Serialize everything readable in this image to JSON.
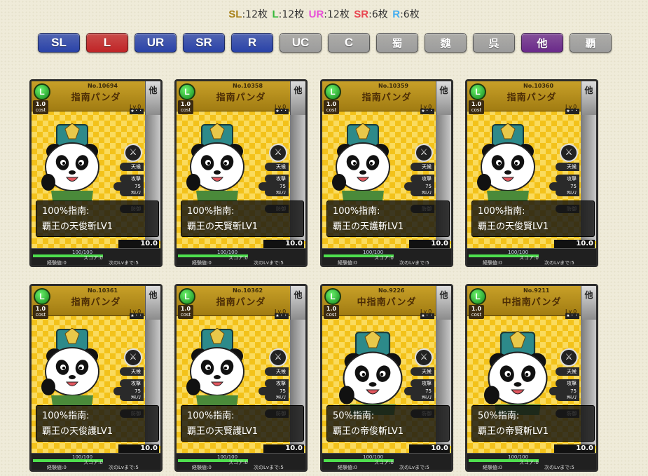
{
  "summary": [
    {
      "label": "SL",
      "count": "12枚",
      "color": "#a8821a"
    },
    {
      "label": "L",
      "count": "12枚",
      "color": "#35b83a"
    },
    {
      "label": "UR",
      "count": "12枚",
      "color": "#e84fd8"
    },
    {
      "label": "SR",
      "count": "6枚",
      "color": "#e8454f"
    },
    {
      "label": "R",
      "count": "6枚",
      "color": "#45aef0"
    }
  ],
  "filters": [
    {
      "label": "SL",
      "color": "#2a43a8",
      "kanji": false
    },
    {
      "label": "L",
      "color": "#c02527",
      "kanji": false
    },
    {
      "label": "UR",
      "color": "#2a43a8",
      "kanji": false
    },
    {
      "label": "SR",
      "color": "#2a43a8",
      "kanji": false
    },
    {
      "label": "R",
      "color": "#2a43a8",
      "kanji": false
    },
    {
      "label": "UC",
      "color": "#9c9c9c",
      "kanji": false
    },
    {
      "label": "C",
      "color": "#9c9c9c",
      "kanji": false
    },
    {
      "label": "蜀",
      "color": "#9c9c9c",
      "kanji": true
    },
    {
      "label": "魏",
      "color": "#9c9c9c",
      "kanji": true
    },
    {
      "label": "呉",
      "color": "#9c9c9c",
      "kanji": true
    },
    {
      "label": "他",
      "color": "#6a2a8a",
      "kanji": true
    },
    {
      "label": "覇",
      "color": "#9c9c9c",
      "kanji": true
    }
  ],
  "cards": [
    {
      "no": "No.10694",
      "name": "指南パンダ",
      "rarity": "L",
      "cost": "1.0",
      "level": "Lv.0",
      "faction": "他",
      "attack": "75",
      "skill_pct": "100%指南:",
      "skill_name": "覇王の天俊斬LV1",
      "value": "10.0",
      "hp": "100/100",
      "score": "スコア:0",
      "exp": "経験値:0",
      "next": "次のLvまで:5",
      "big": false
    },
    {
      "no": "No.10358",
      "name": "指南パンダ",
      "rarity": "L",
      "cost": "1.0",
      "level": "Lv.0",
      "faction": "他",
      "attack": "75",
      "skill_pct": "100%指南:",
      "skill_name": "覇王の天賢斬LV1",
      "value": "10.0",
      "hp": "100/100",
      "score": "スコア:0",
      "exp": "経験値:0",
      "next": "次のLvまで:5",
      "big": false
    },
    {
      "no": "No.10359",
      "name": "指南パンダ",
      "rarity": "L",
      "cost": "1.0",
      "level": "Lv.0",
      "faction": "他",
      "attack": "75",
      "skill_pct": "100%指南:",
      "skill_name": "覇王の天護斬LV1",
      "value": "10.0",
      "hp": "100/100",
      "score": "スコア:0",
      "exp": "経験値:0",
      "next": "次のLvまで:5",
      "big": false
    },
    {
      "no": "No.10360",
      "name": "指南パンダ",
      "rarity": "L",
      "cost": "1.0",
      "level": "Lv.0",
      "faction": "他",
      "attack": "75",
      "skill_pct": "100%指南:",
      "skill_name": "覇王の天俊賢LV1",
      "value": "10.0",
      "hp": "100/100",
      "score": "スコア:0",
      "exp": "経験値:0",
      "next": "次のLvまで:5",
      "big": false
    },
    {
      "no": "No.10361",
      "name": "指南パンダ",
      "rarity": "L",
      "cost": "1.0",
      "level": "Lv.0",
      "faction": "他",
      "attack": "75",
      "skill_pct": "100%指南:",
      "skill_name": "覇王の天俊護LV1",
      "value": "10.0",
      "hp": "100/100",
      "score": "スコア:0",
      "exp": "経験値:0",
      "next": "次のLvまで:5",
      "big": false
    },
    {
      "no": "No.10362",
      "name": "指南パンダ",
      "rarity": "L",
      "cost": "1.0",
      "level": "Lv.0",
      "faction": "他",
      "attack": "75",
      "skill_pct": "100%指南:",
      "skill_name": "覇王の天賢護LV1",
      "value": "10.0",
      "hp": "100/100",
      "score": "スコア:0",
      "exp": "経験値:0",
      "next": "次のLvまで:5",
      "big": false
    },
    {
      "no": "No.9226",
      "name": "中指南パンダ",
      "rarity": "L",
      "cost": "1.0",
      "level": "Lv.0",
      "faction": "他",
      "attack": "75",
      "skill_pct": "50%指南:",
      "skill_name": "覇王の帝俊斬LV1",
      "value": "10.0",
      "hp": "100/100",
      "score": "スコア:0",
      "exp": "経験値:0",
      "next": "次のLvまで:5",
      "big": true
    },
    {
      "no": "No.9211",
      "name": "中指南パンダ",
      "rarity": "L",
      "cost": "1.0",
      "level": "Lv.0",
      "faction": "他",
      "attack": "75",
      "skill_pct": "50%指南:",
      "skill_name": "覇王の帝賢斬LV1",
      "value": "10.0",
      "hp": "100/100",
      "score": "スコア:0",
      "exp": "経験値:0",
      "next": "次のLvまで:5",
      "big": true
    }
  ],
  "card_static": {
    "cost_label": "cost",
    "stat_labels": [
      "天候",
      "攻撃",
      "知力",
      "防御"
    ],
    "stars": "★・・"
  },
  "icons": {
    "weapon": "sword-icon",
    "art": "panda-general-icon"
  }
}
